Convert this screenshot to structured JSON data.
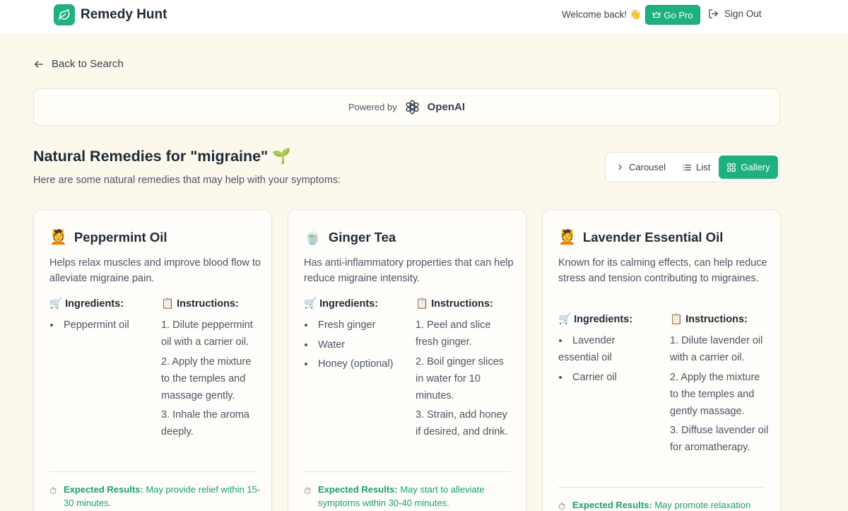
{
  "header": {
    "app_title": "Remedy Hunt",
    "welcome": "Welcome back! 👋",
    "go_pro_label": "Go Pro",
    "sign_out_label": "Sign Out",
    "brand_color": "#1fb07e"
  },
  "back_label": "Back to Search",
  "powered": {
    "label": "Powered by",
    "provider": "OpenAI"
  },
  "page": {
    "title": "Natural Remedies for \"migraine\" 🌱",
    "subtitle": "Here are some natural remedies that may help with your symptoms:"
  },
  "view_switch": {
    "carousel": "Carousel",
    "list": "List",
    "gallery": "Gallery",
    "selected": "Gallery"
  },
  "labels": {
    "ingredients": "🛒 Ingredients:",
    "instructions": "📋 Instructions:",
    "expected": "Expected Results:"
  },
  "remedies": [
    {
      "emoji": "💆",
      "name": "Peppermint Oil",
      "description": "Helps relax muscles and improve blood flow to alleviate migraine pain.",
      "ingredients": [
        "Peppermint oil"
      ],
      "instructions": [
        "1. Dilute peppermint oil with a carrier oil.",
        "2. Apply the mixture to the temples and massage gently.",
        "3. Inhale the aroma deeply."
      ],
      "expected": "May provide relief within 15-30 minutes."
    },
    {
      "emoji": "🍵",
      "name": "Ginger Tea",
      "description": "Has anti-inflammatory properties that can help reduce migraine intensity.",
      "ingredients": [
        "Fresh ginger",
        "Water",
        "Honey (optional)"
      ],
      "instructions": [
        "1. Peel and slice fresh ginger.",
        "2. Boil ginger slices in water for 10 minutes.",
        "3. Strain, add honey if desired, and drink."
      ],
      "expected": "May start to alleviate symptoms within 30-40 minutes."
    },
    {
      "emoji": "💆",
      "name": "Lavender Essential Oil",
      "description": "Known for its calming effects, can help reduce stress and tension contributing to migraines.",
      "ingredients": [
        "Lavender essential oil",
        "Carrier oil"
      ],
      "instructions": [
        "1. Dilute lavender oil with a carrier oil.",
        "2. Apply the mixture to the temples and gently massage.",
        "3. Diffuse lavender oil for aromatherapy."
      ],
      "expected": "May promote relaxation"
    }
  ]
}
